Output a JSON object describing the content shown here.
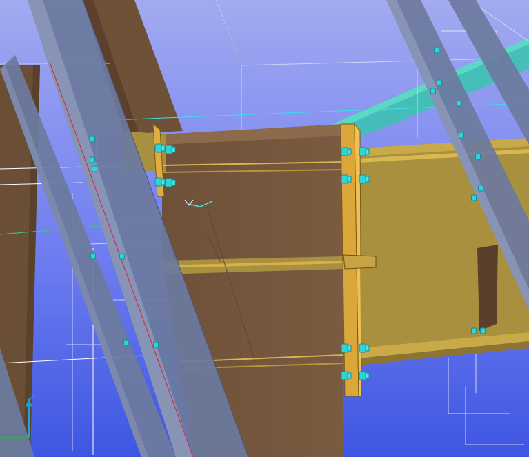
{
  "viewport": {
    "background_top": "#9ea8f0",
    "background_bottom": "#3f58e4",
    "colors": {
      "steel_section": "#6c7a9e",
      "steel_section_light": "#8d98b6",
      "beam_brown": "#72553d",
      "beam_brown_dark": "#5c4330",
      "beam_yellow": "#a8903e",
      "plate_yellow": "#dba63a",
      "plate_yellow_light": "#efc055",
      "bolt_cyan": "#31d7d8",
      "cyan_member": "#36bfae",
      "selection_white": "#ffffff",
      "red_line": "#d32535",
      "green_axis": "#28b04a",
      "blue_axis": "#1fa4d2"
    },
    "icons": [
      "bolt-icon",
      "axis-triad-icon",
      "cursor-marker-icon"
    ],
    "axis": {
      "z_label": "Z"
    }
  }
}
